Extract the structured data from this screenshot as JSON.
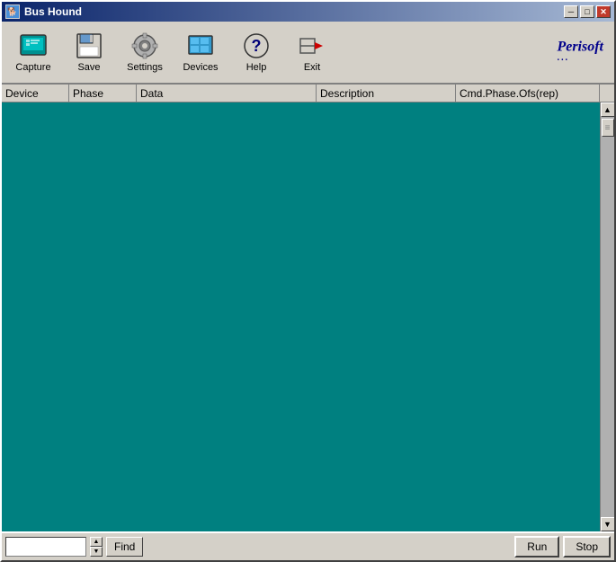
{
  "window": {
    "title": "Bus Hound",
    "title_icon": "🐕"
  },
  "title_buttons": {
    "minimize": "─",
    "maximize": "□",
    "close": "✕"
  },
  "toolbar": {
    "buttons": [
      {
        "id": "capture",
        "label": "Capture"
      },
      {
        "id": "save",
        "label": "Save"
      },
      {
        "id": "settings",
        "label": "Settings"
      },
      {
        "id": "devices",
        "label": "Devices"
      },
      {
        "id": "help",
        "label": "Help"
      },
      {
        "id": "exit",
        "label": "Exit"
      }
    ],
    "logo_line1": "Perisoft",
    "logo_line2": "···"
  },
  "columns": {
    "headers": [
      "Device",
      "Phase",
      "Data",
      "Description",
      "Cmd.Phase.Ofs(rep)"
    ]
  },
  "bottom_bar": {
    "search_placeholder": "",
    "find_label": "Find",
    "run_label": "Run",
    "stop_label": "Stop"
  }
}
